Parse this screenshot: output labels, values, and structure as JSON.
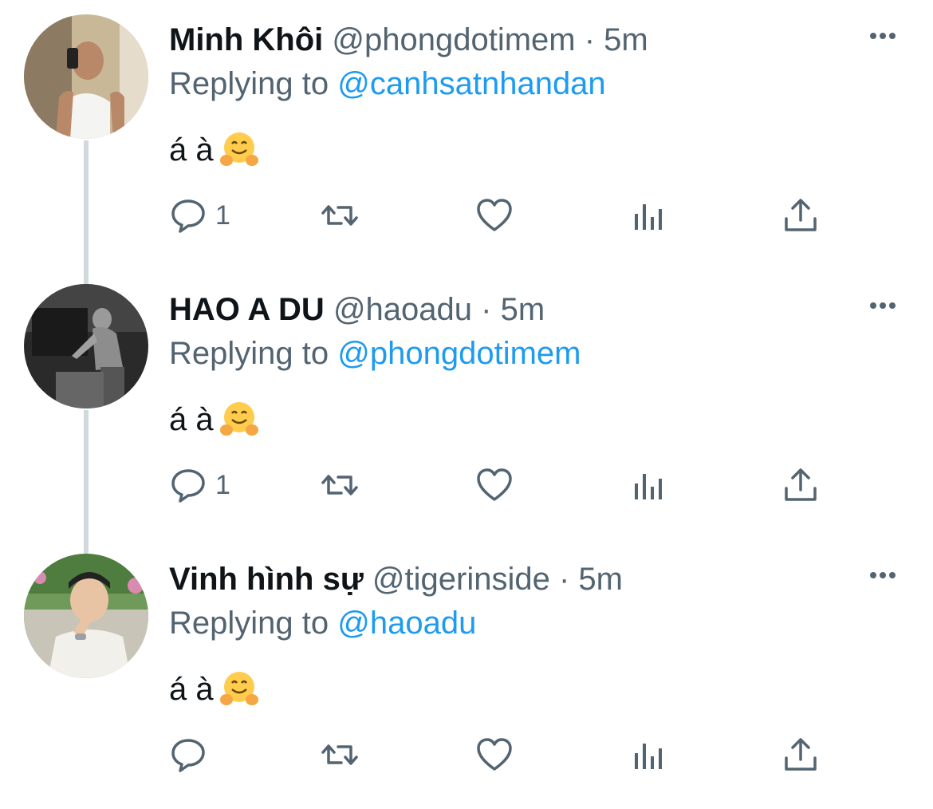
{
  "colors": {
    "text": "#0f1419",
    "muted": "#536471",
    "link": "#1d9bf0",
    "thread_line": "#cfd9de"
  },
  "icons": {
    "more": "more-horizontal-icon",
    "reply": "reply-icon",
    "retweet": "retweet-icon",
    "like": "heart-icon",
    "stats": "bar-chart-icon",
    "share": "share-icon",
    "emoji": "hugging-face-emoji"
  },
  "tweets": [
    {
      "name": "Minh Khôi",
      "handle": "@phongdotimem",
      "time": "· 5m",
      "replying_prefix": "Replying to",
      "replying_to": "@canhsatnhandan",
      "text": "á à",
      "reply_count": "1"
    },
    {
      "name": "HAO A DU",
      "handle": "@haoadu",
      "time": "· 5m",
      "replying_prefix": "Replying to",
      "replying_to": "@phongdotimem",
      "text": "á à",
      "reply_count": "1"
    },
    {
      "name": "Vinh hình sự",
      "handle": "@tigerinside",
      "time": "· 5m",
      "replying_prefix": "Replying to",
      "replying_to": "@haoadu",
      "text": "á à",
      "reply_count": ""
    }
  ]
}
